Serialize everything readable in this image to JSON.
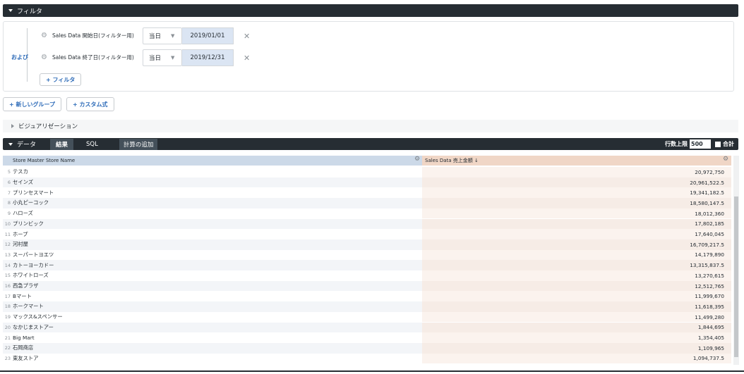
{
  "filter_section": {
    "title": "フィルタ"
  },
  "filters": {
    "conjunction": "および",
    "rows": [
      {
        "label": "Sales Data 開始日(フィルター用)",
        "operator": "当日",
        "value": "2019/01/01"
      },
      {
        "label": "Sales Data 終了日(フィルター用)",
        "operator": "当日",
        "value": "2019/12/31"
      }
    ],
    "add_filter": "+ フィルタ"
  },
  "actions": {
    "new_group": "+ 新しいグループ",
    "custom_expression": "+ カスタム式"
  },
  "visualization": {
    "title": "ビジュアリゼーション"
  },
  "data_bar": {
    "title": "データ",
    "tabs": {
      "results": "結果",
      "sql": "SQL",
      "add_calc": "計算の追加"
    },
    "row_limit_label": "行数上限",
    "row_limit_value": "500",
    "total_label": "合計"
  },
  "table": {
    "columns": [
      "Store Master Store Name",
      "Sales Data 売上金額 ↓"
    ],
    "rows": [
      {
        "n": "5",
        "name": "テスカ",
        "value": "20,972,750"
      },
      {
        "n": "6",
        "name": "セインズ",
        "value": "20,961,522.5"
      },
      {
        "n": "7",
        "name": "プリンセスマート",
        "value": "19,341,182.5"
      },
      {
        "n": "8",
        "name": "小丸ピーコック",
        "value": "18,580,147.5"
      },
      {
        "n": "9",
        "name": "ハローズ",
        "value": "18,012,360"
      },
      {
        "n": "10",
        "name": "プリンビック",
        "value": "17,802,185"
      },
      {
        "n": "11",
        "name": "ホープ",
        "value": "17,640,045"
      },
      {
        "n": "12",
        "name": "河村屋",
        "value": "16,709,217.5"
      },
      {
        "n": "13",
        "name": "スーパートヨエツ",
        "value": "14,179,890"
      },
      {
        "n": "14",
        "name": "カトーヨーカドー",
        "value": "13,315,837.5"
      },
      {
        "n": "15",
        "name": "ホワイトローズ",
        "value": "13,270,615"
      },
      {
        "n": "16",
        "name": "西急プラザ",
        "value": "12,512,765"
      },
      {
        "n": "17",
        "name": "Bマート",
        "value": "11,999,670"
      },
      {
        "n": "18",
        "name": "ホークマート",
        "value": "11,618,395"
      },
      {
        "n": "19",
        "name": "マックス&スペンサー",
        "value": "11,499,280"
      },
      {
        "n": "20",
        "name": "なかじまストアー",
        "value": "1,844,695"
      },
      {
        "n": "21",
        "name": "Big Mart",
        "value": "1,354,405"
      },
      {
        "n": "22",
        "name": "石岡商店",
        "value": "1,109,965"
      },
      {
        "n": "23",
        "name": "東友ストア",
        "value": "1,094,737.5"
      }
    ]
  },
  "colors": {
    "dark_bar": "#262d33",
    "name_header": "#ccd9e8",
    "value_header": "#f0d6c6",
    "link": "#2d6bb8"
  }
}
